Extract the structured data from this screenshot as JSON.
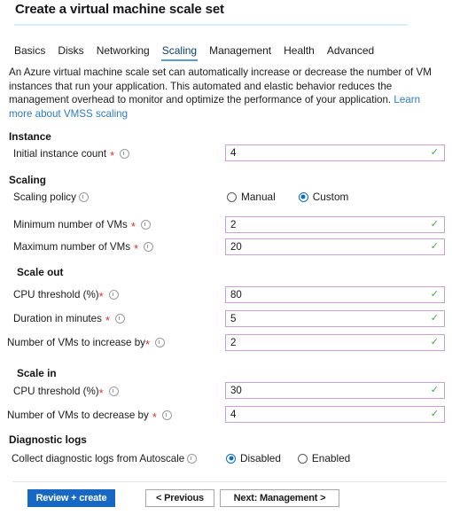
{
  "header": {
    "title": "Create a virtual machine scale set"
  },
  "tabs": [
    {
      "label": "Basics",
      "active": false
    },
    {
      "label": "Disks",
      "active": false
    },
    {
      "label": "Networking",
      "active": false
    },
    {
      "label": "Scaling",
      "active": true
    },
    {
      "label": "Management",
      "active": false
    },
    {
      "label": "Health",
      "active": false
    },
    {
      "label": "Advanced",
      "active": false
    }
  ],
  "description": {
    "text": "An Azure virtual machine scale set can automatically increase or decrease the number of VM instances that run your application. This automated and elastic behavior reduces the management overhead to monitor and optimize the performance of your application. ",
    "link_label": "Learn more about VMSS scaling"
  },
  "sections": {
    "instance": {
      "heading": "Instance",
      "initial_instance_count": {
        "label": "Initial instance count",
        "value": "4",
        "required": true,
        "validated": true
      }
    },
    "scaling": {
      "heading": "Scaling",
      "scaling_policy": {
        "label": "Scaling policy",
        "options": [
          "Manual",
          "Custom"
        ],
        "selected": "Custom"
      },
      "minimum_vms": {
        "label": "Minimum number of VMs",
        "value": "2",
        "required": true,
        "validated": true
      },
      "maximum_vms": {
        "label": "Maximum number of VMs",
        "value": "20",
        "required": true,
        "validated": true
      }
    },
    "scale_out": {
      "heading": "Scale out",
      "cpu_threshold": {
        "label": "CPU threshold (%)",
        "value": "80",
        "required": true,
        "validated": true
      },
      "duration_minutes": {
        "label": "Duration in minutes",
        "value": "5",
        "required": true,
        "validated": true
      },
      "vms_increase_by": {
        "label": "Number of VMs to increase by",
        "value": "2",
        "required": true,
        "validated": true
      }
    },
    "scale_in": {
      "heading": "Scale in",
      "cpu_threshold": {
        "label": "CPU threshold (%)",
        "value": "30",
        "required": true,
        "validated": true
      },
      "vms_decrease_by": {
        "label": "Number of VMs to decrease by",
        "value": "4",
        "required": true,
        "validated": true
      }
    },
    "diagnostic_logs": {
      "heading": "Diagnostic logs",
      "collect_logs": {
        "label": "Collect diagnostic logs from Autoscale",
        "options": [
          "Disabled",
          "Enabled"
        ],
        "selected": "Disabled"
      }
    }
  },
  "footer": {
    "review_create": "Review + create",
    "previous": "< Previous",
    "next": "Next: Management >"
  },
  "colors": {
    "accent_blue": "#1668c3",
    "tab_underline": "#5b9bd5",
    "link": "#2d7bbd",
    "field_border": "#c9a0ce",
    "valid_check": "#43a047",
    "required_asterisk": "#d63030",
    "title_rule": "#d7eef8"
  },
  "icons": {
    "info": "info-circle-icon",
    "check": "✓",
    "required": "*"
  }
}
